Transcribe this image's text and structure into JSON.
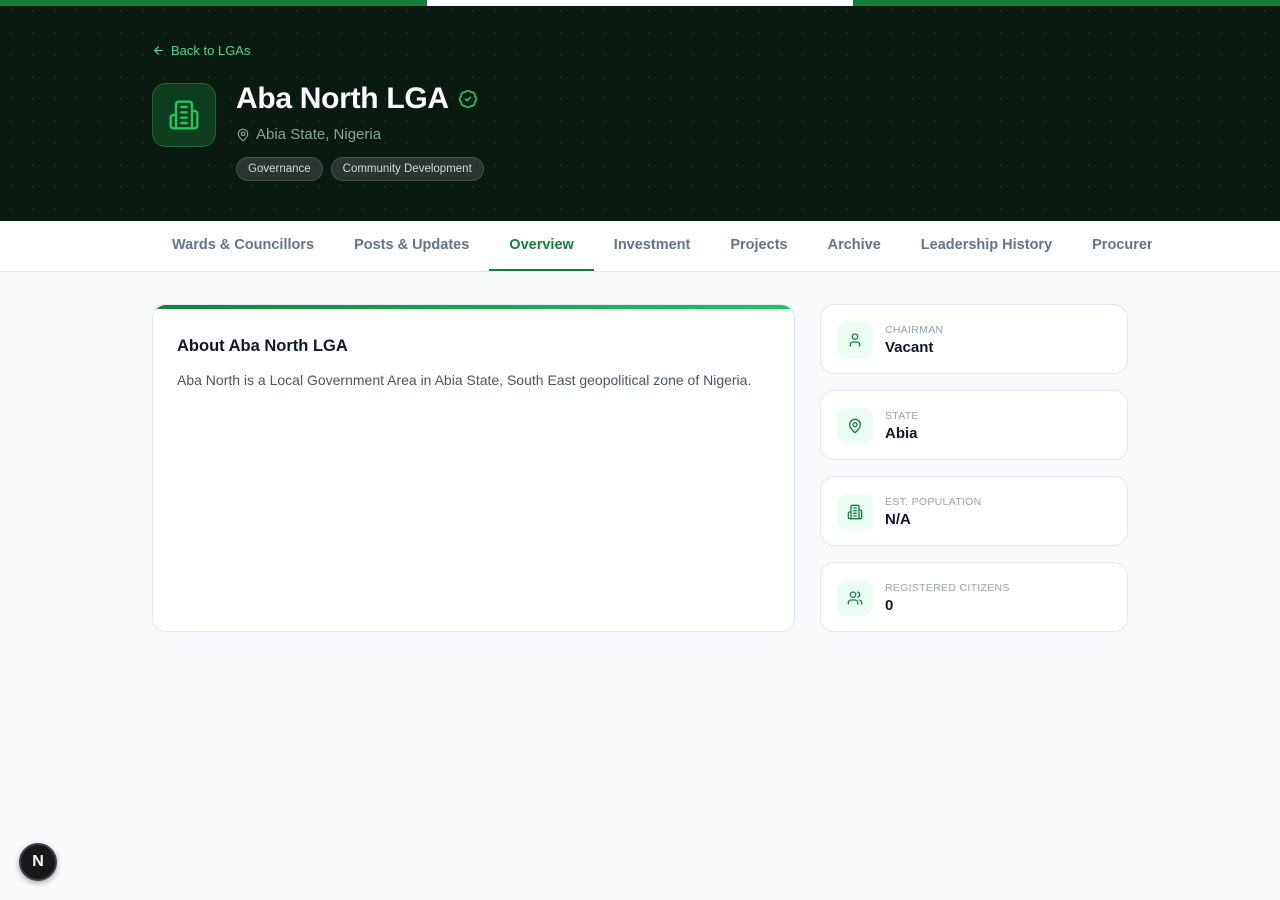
{
  "header": {
    "back_link": "Back to LGAs",
    "title": "Aba North LGA",
    "location": "Abia State, Nigeria",
    "tags": [
      "Governance",
      "Community Development"
    ]
  },
  "tabs": [
    {
      "label": "Wards & Councillors",
      "active": false
    },
    {
      "label": "Posts & Updates",
      "active": false
    },
    {
      "label": "Overview",
      "active": true
    },
    {
      "label": "Investment",
      "active": false
    },
    {
      "label": "Projects",
      "active": false
    },
    {
      "label": "Archive",
      "active": false
    },
    {
      "label": "Leadership History",
      "active": false
    },
    {
      "label": "Procurement",
      "active": false
    }
  ],
  "about": {
    "title": "About Aba North LGA",
    "text": "Aba North is a Local Government Area in Abia State, South East geopolitical zone of Nigeria."
  },
  "stats": [
    {
      "label": "CHAIRMAN",
      "value": "Vacant",
      "icon": "user-icon"
    },
    {
      "label": "STATE",
      "value": "Abia",
      "icon": "map-pin-icon"
    },
    {
      "label": "EST. POPULATION",
      "value": "N/A",
      "icon": "building-icon"
    },
    {
      "label": "REGISTERED CITIZENS",
      "value": "0",
      "icon": "users-icon"
    }
  ],
  "dev_badge": "N",
  "colors": {
    "accent": "#15803d",
    "hero_bg": "#0b1a10",
    "link": "#4ade80"
  }
}
